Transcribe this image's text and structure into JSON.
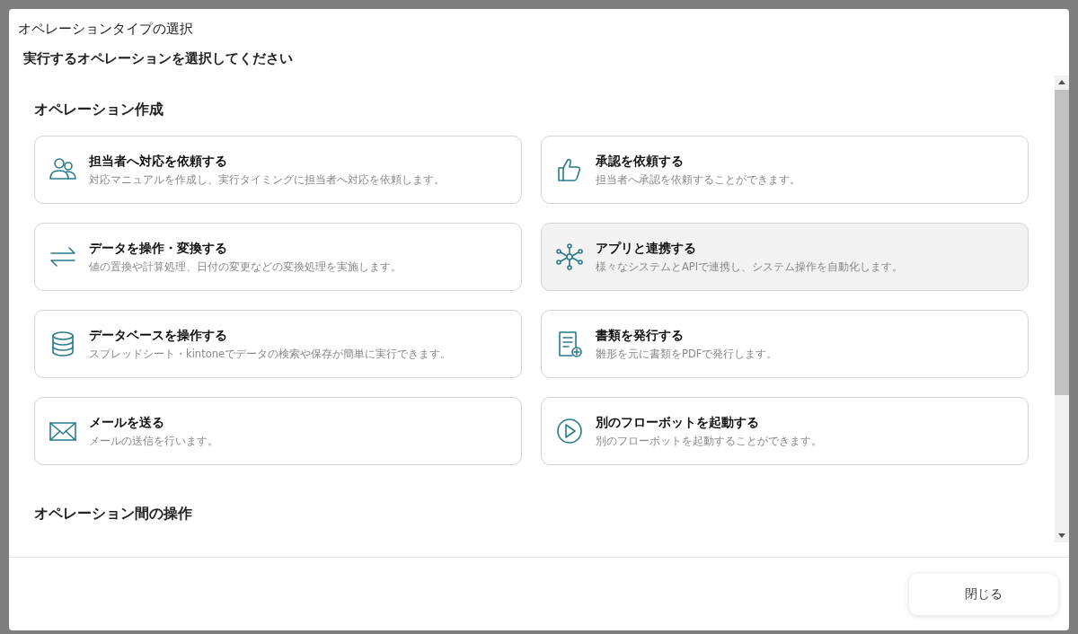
{
  "dialog": {
    "title": "オペレーションタイプの選択",
    "subtitle": "実行するオペレーションを選択してください"
  },
  "sections": [
    {
      "heading": "オペレーション作成",
      "cards": [
        {
          "kind": "people",
          "title": "担当者へ対応を依頼する",
          "description": "対応マニュアルを作成し、実行タイミングに担当者へ対応を依頼します。",
          "highlighted": false
        },
        {
          "kind": "thumbs-up",
          "title": "承認を依頼する",
          "description": "担当者へ承認を依頼することができます。",
          "highlighted": false
        },
        {
          "kind": "arrows",
          "title": "データを操作・変換する",
          "description": "値の置換や計算処理、日付の変更などの変換処理を実施します。",
          "highlighted": false
        },
        {
          "kind": "network",
          "title": "アプリと連携する",
          "description": "様々なシステムとAPIで連携し、システム操作を自動化します。",
          "highlighted": true
        },
        {
          "kind": "database",
          "title": "データベースを操作する",
          "description": "スプレッドシート・kintoneでデータの検索や保存が簡単に実行できます。",
          "highlighted": false
        },
        {
          "kind": "document",
          "title": "書類を発行する",
          "description": "雛形を元に書類をPDFで発行します。",
          "highlighted": false
        },
        {
          "kind": "mail",
          "title": "メールを送る",
          "description": "メールの送信を行います。",
          "highlighted": false
        },
        {
          "kind": "play",
          "title": "別のフローボットを起動する",
          "description": "別のフローボットを起動することができます。",
          "highlighted": false
        }
      ]
    },
    {
      "heading": "オペレーション間の操作"
    }
  ],
  "footer": {
    "close_button": "閉じる"
  }
}
